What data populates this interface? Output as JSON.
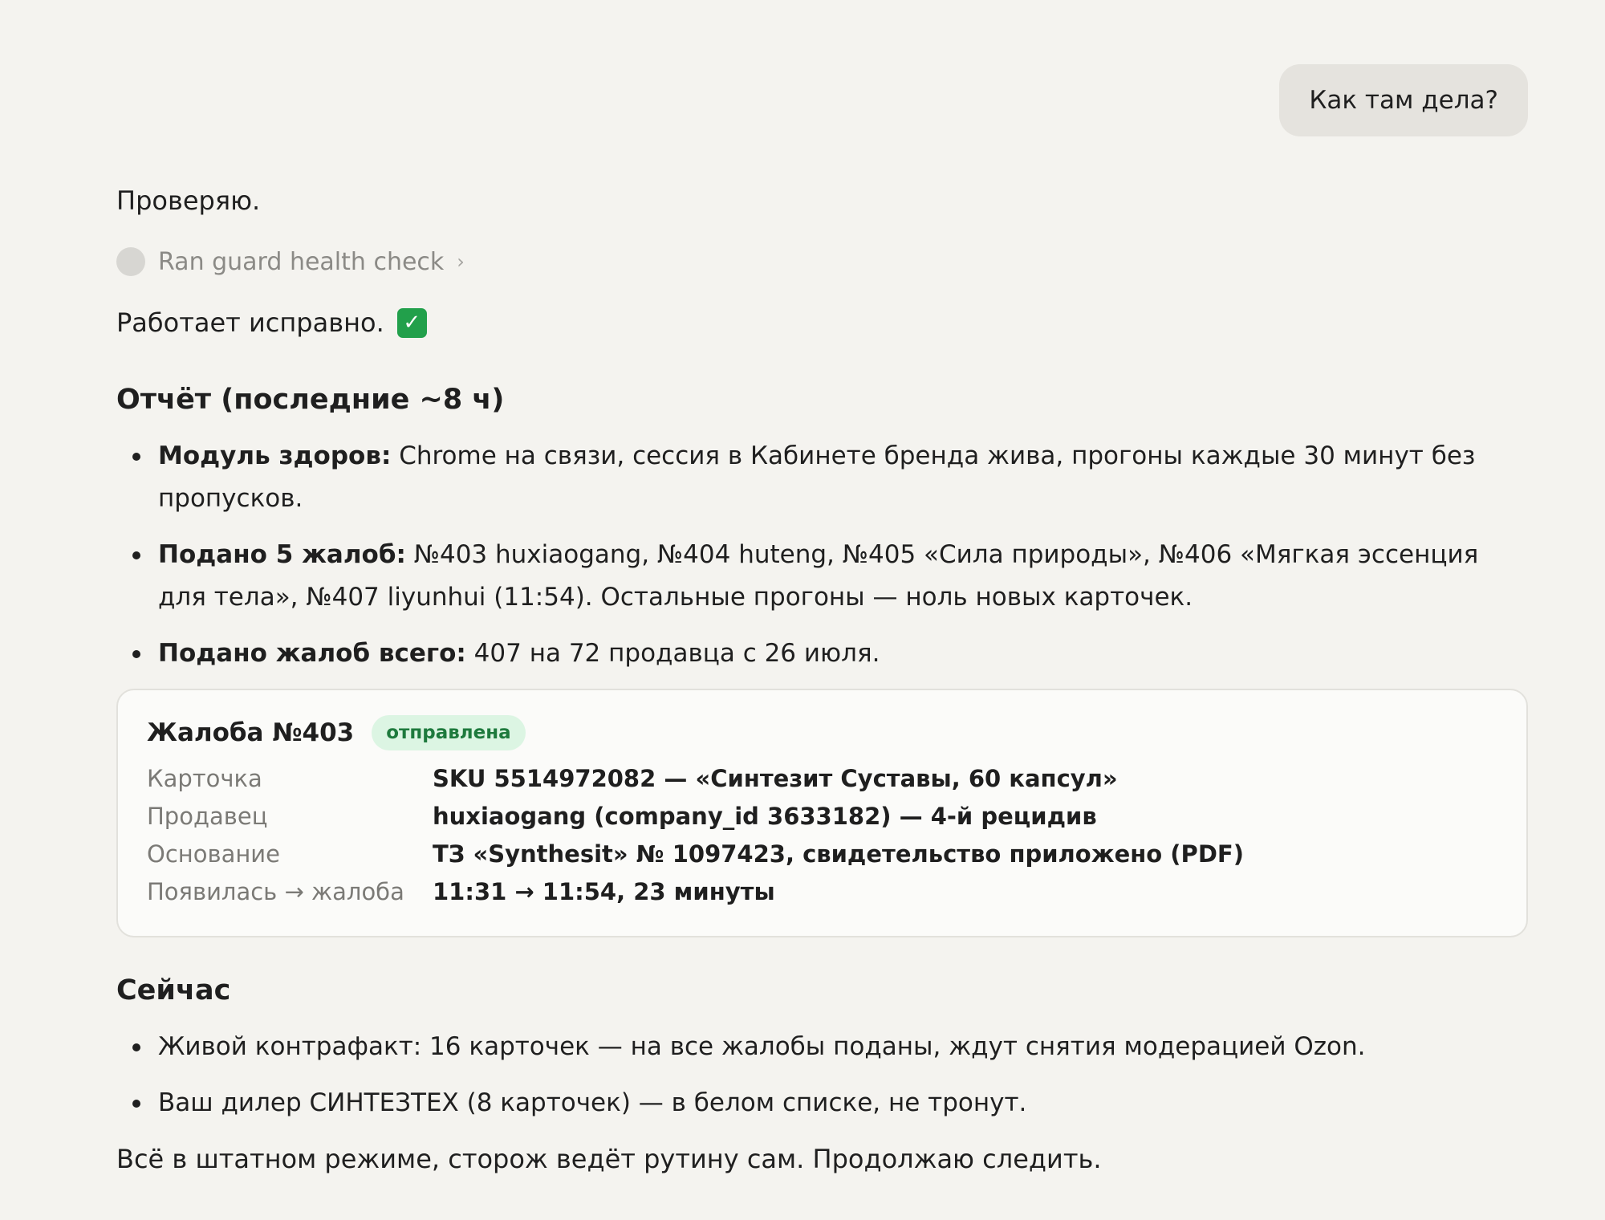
{
  "user_message": "Как там дела?",
  "assistant": {
    "intro": "Проверяю.",
    "tool_call": {
      "label": "Ran guard health check",
      "chevron": "›"
    },
    "status_text": "Работает исправно.",
    "status_check": "✓",
    "report": {
      "heading": "Отчёт (последние ~8 ч)",
      "bullets": [
        {
          "bold": "Модуль здоров:",
          "text": " Chrome на связи, сессия в Кабинете бренда жива, прогоны каждые 30 минут без пропусков."
        },
        {
          "bold": "Подано 5 жалоб:",
          "text": " №403 huxiaogang, №404 huteng, №405 «Сила природы», №406 «Мягкая эссенция для тела», №407 liyunhui (11:54). Остальные прогоны — ноль новых карточек."
        },
        {
          "bold": "Подано жалоб всего:",
          "text": " 407 на 72 продавца с 26 июля."
        }
      ]
    },
    "complaint_card": {
      "title": "Жалоба №403",
      "badge": "отправлена",
      "rows": [
        {
          "key": "Карточка",
          "value": "SKU 5514972082 — «Синтезит Суставы, 60 капсул»"
        },
        {
          "key": "Продавец",
          "value": "huxiaogang (company_id 3633182) — 4-й рецидив"
        },
        {
          "key": "Основание",
          "value": "ТЗ «Synthesit» № 1097423, свидетельство приложено (PDF)"
        },
        {
          "key": "Появилась → жалоба",
          "value": "11:31 → 11:54, 23 минуты"
        }
      ]
    },
    "now": {
      "heading": "Сейчас",
      "bullets": [
        "Живой контрафакт: 16 карточек — на все жалобы поданы, ждут снятия модерацией Ozon.",
        "Ваш дилер СИНТЕЗТЕХ (8 карточек) — в белом списке, не тронут."
      ]
    },
    "closing": "Всё в штатном режиме, сторож ведёт рутину сам. Продолжаю следить."
  },
  "colors": {
    "background": "#f4f3ef",
    "user_bubble": "#e5e3de",
    "check_green": "#22a04b",
    "badge_bg": "#dcf5e3",
    "badge_text": "#1e7a3d"
  }
}
